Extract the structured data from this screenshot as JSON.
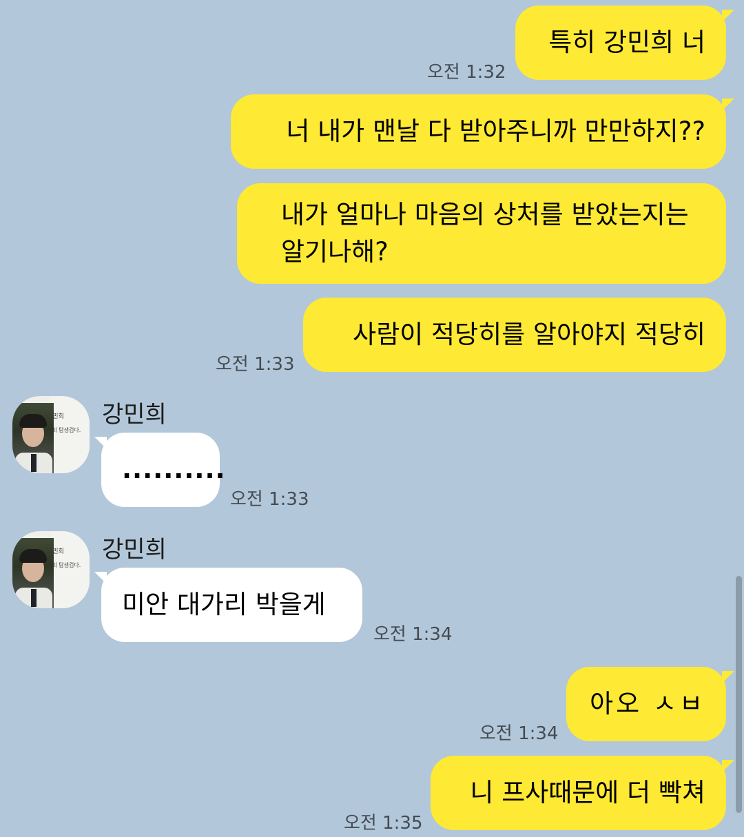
{
  "messages": [
    {
      "side": "me",
      "text": "특히 강민희 너",
      "time": "오전 1:32"
    },
    {
      "side": "me",
      "text": "너 내가 맨날 다 받아주니까 만만하지??",
      "time": ""
    },
    {
      "side": "me",
      "text": "내가 얼마나 마음의 상처를 받았는지는 알기나해?",
      "time": ""
    },
    {
      "side": "me",
      "text": "사람이 적당히를 알아야지 적당히",
      "time": "오전 1:33"
    },
    {
      "side": "them",
      "sender": "강민희",
      "text": "..........",
      "time": "오전 1:33"
    },
    {
      "side": "them",
      "sender": "강민희",
      "text": "미안 대가리 박을게",
      "time": "오전 1:34"
    },
    {
      "side": "me",
      "text": "아오 ㅅㅂ",
      "time": "오전 1:34"
    },
    {
      "side": "me",
      "text": "니 프사때문에 더 빡쳐",
      "time": "오전 1:35"
    }
  ],
  "avatar": {
    "card_name": "강민희",
    "card_note": "미희 탐생겁다."
  },
  "colors": {
    "background": "#b2c7d9",
    "my_bubble": "#fee934",
    "their_bubble": "#ffffff",
    "time_text": "#444b52"
  },
  "icons": {
    "avatar": "profile-photo"
  }
}
